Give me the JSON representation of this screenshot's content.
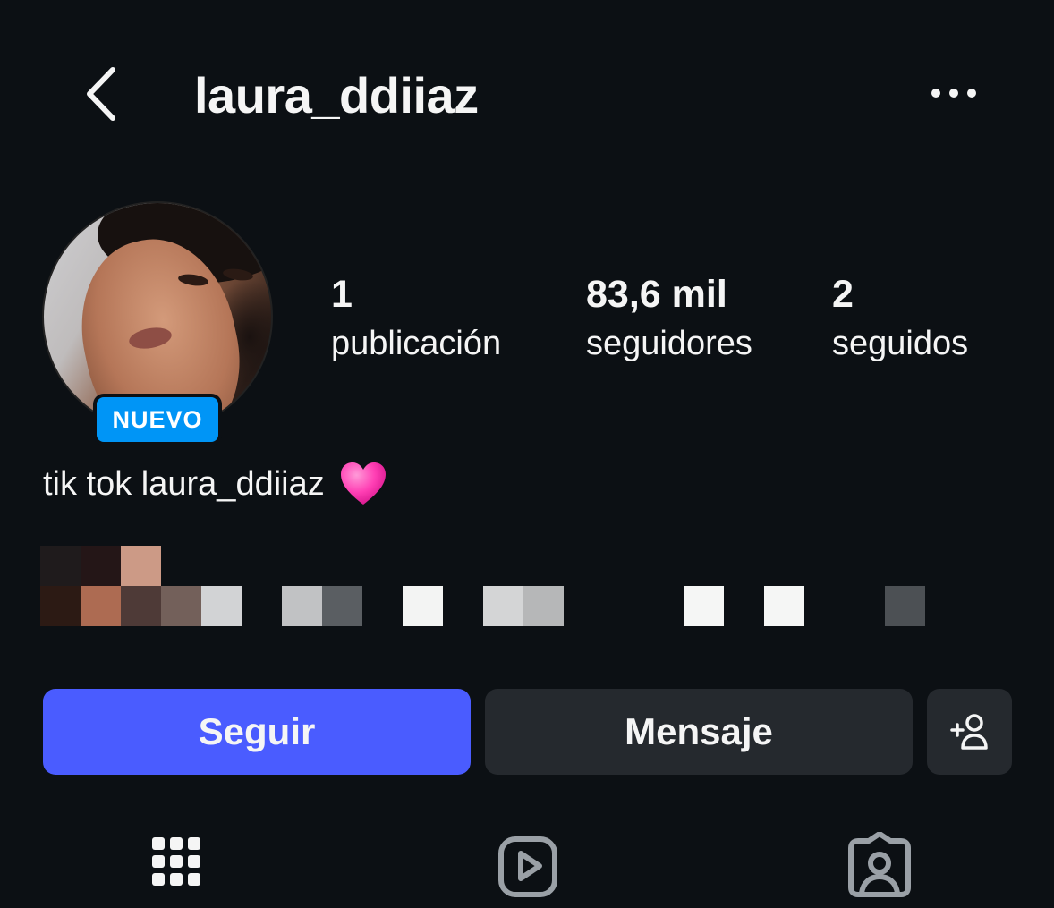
{
  "header": {
    "username": "laura_ddiiaz",
    "back_icon": "chevron-left-icon",
    "more_icon": "more-horizontal-icon"
  },
  "profile": {
    "new_badge": "NUEVO",
    "stats": {
      "posts_value": "1",
      "posts_label": "publicación",
      "followers_value": "83,6 mil",
      "followers_label": "seguidores",
      "following_value": "2",
      "following_label": "seguidos"
    },
    "bio": "tik tok laura_ddiiaz",
    "bio_emoji": "pink-heart-icon"
  },
  "actions": {
    "follow_label": "Seguir",
    "message_label": "Mensaje",
    "add_user_icon": "add-user-icon"
  },
  "tabs": [
    {
      "icon": "grid-icon"
    },
    {
      "icon": "reels-icon"
    },
    {
      "icon": "tagged-icon"
    }
  ],
  "colors": {
    "background": "#0c1014",
    "follow_button": "#4a5cff",
    "secondary_button": "#25292e",
    "badge": "#0095f6"
  }
}
